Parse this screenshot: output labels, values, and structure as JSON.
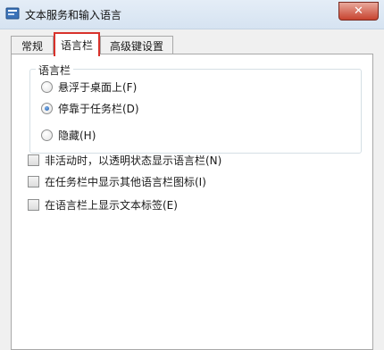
{
  "window": {
    "title": "文本服务和输入语言",
    "close_label": "✕",
    "accent_close": "#c7432f",
    "highlight": "#d8322b"
  },
  "tabs": [
    {
      "label": "常规",
      "active": false
    },
    {
      "label": "语言栏",
      "active": true
    },
    {
      "label": "高级键设置",
      "active": false
    }
  ],
  "language_bar": {
    "group_title": "语言栏",
    "options": [
      {
        "label": "悬浮于桌面上(F)",
        "selected": false
      },
      {
        "label": "停靠于任务栏(D)",
        "selected": true
      },
      {
        "label": "隐藏(H)",
        "selected": false
      }
    ]
  },
  "checkboxes": [
    {
      "label": "非活动时，以透明状态显示语言栏(N)",
      "checked": false
    },
    {
      "label": "在任务栏中显示其他语言栏图标(I)",
      "checked": false
    },
    {
      "label": "在语言栏上显示文本标签(E)",
      "checked": false
    }
  ]
}
